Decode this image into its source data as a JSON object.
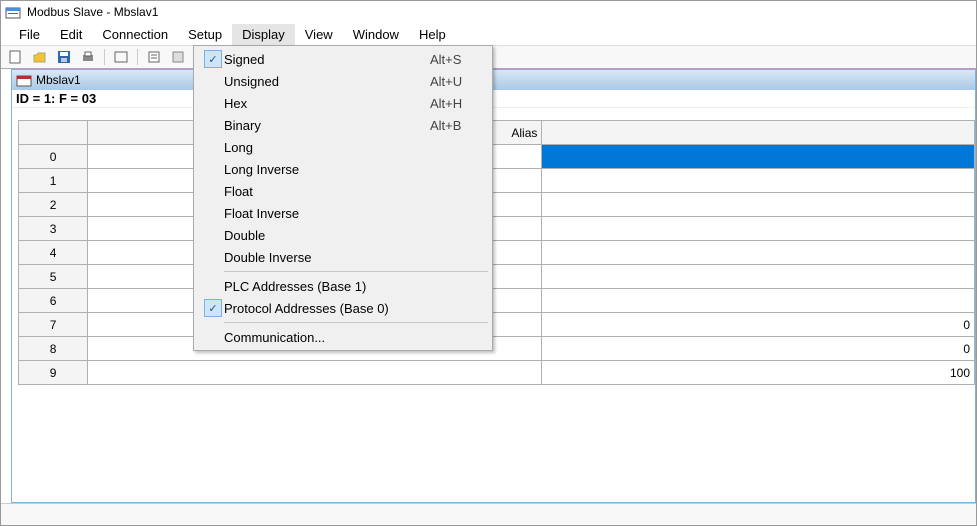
{
  "app": {
    "title": "Modbus Slave - Mbslav1"
  },
  "menu": {
    "file": "File",
    "edit": "Edit",
    "connection": "Connection",
    "setup": "Setup",
    "display": "Display",
    "view": "View",
    "window": "Window",
    "help": "Help"
  },
  "dropdown": {
    "signed": {
      "label": "Signed",
      "shortcut": "Alt+S",
      "checked": true
    },
    "unsigned": {
      "label": "Unsigned",
      "shortcut": "Alt+U",
      "checked": false
    },
    "hex": {
      "label": "Hex",
      "shortcut": "Alt+H",
      "checked": false
    },
    "binary": {
      "label": "Binary",
      "shortcut": "Alt+B",
      "checked": false
    },
    "long": {
      "label": "Long"
    },
    "long_inverse": {
      "label": "Long Inverse"
    },
    "float": {
      "label": "Float"
    },
    "float_inverse": {
      "label": "Float Inverse"
    },
    "double": {
      "label": "Double"
    },
    "double_inverse": {
      "label": "Double Inverse"
    },
    "plc_addr": {
      "label": "PLC Addresses (Base 1)",
      "checked": false
    },
    "proto_addr": {
      "label": "Protocol Addresses (Base 0)",
      "checked": true
    },
    "comm": {
      "label": "Communication..."
    }
  },
  "subwin": {
    "title": "Mbslav1",
    "status": "ID = 1: F = 03"
  },
  "table": {
    "headers": {
      "alias": "Alias",
      "value": ""
    },
    "rows": [
      {
        "idx": "0",
        "alias": "",
        "value": "",
        "selected": true
      },
      {
        "idx": "1",
        "alias": "",
        "value": ""
      },
      {
        "idx": "2",
        "alias": "",
        "value": ""
      },
      {
        "idx": "3",
        "alias": "",
        "value": ""
      },
      {
        "idx": "4",
        "alias": "",
        "value": ""
      },
      {
        "idx": "5",
        "alias": "",
        "value": ""
      },
      {
        "idx": "6",
        "alias": "",
        "value": ""
      },
      {
        "idx": "7",
        "alias": "",
        "value": "0"
      },
      {
        "idx": "8",
        "alias": "",
        "value": "0"
      },
      {
        "idx": "9",
        "alias": "",
        "value": "100"
      }
    ]
  }
}
